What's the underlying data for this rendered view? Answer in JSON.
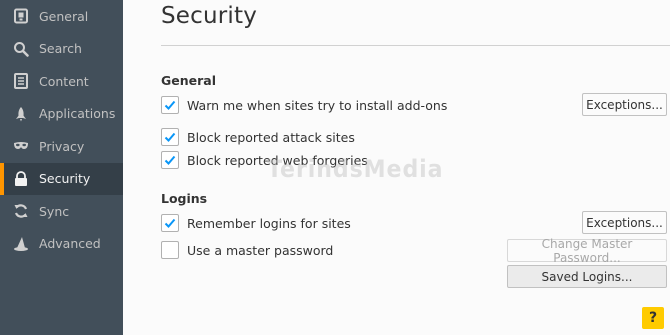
{
  "sidebar": {
    "items": [
      {
        "label": "General",
        "icon": "general-icon",
        "selected": false
      },
      {
        "label": "Search",
        "icon": "search-icon",
        "selected": false
      },
      {
        "label": "Content",
        "icon": "content-icon",
        "selected": false
      },
      {
        "label": "Applications",
        "icon": "rocket-icon",
        "selected": false
      },
      {
        "label": "Privacy",
        "icon": "mask-icon",
        "selected": false
      },
      {
        "label": "Security",
        "icon": "lock-icon",
        "selected": true
      },
      {
        "label": "Sync",
        "icon": "sync-icon",
        "selected": false
      },
      {
        "label": "Advanced",
        "icon": "wizard-hat-icon",
        "selected": false
      }
    ]
  },
  "page": {
    "title": "Security"
  },
  "general": {
    "heading": "General",
    "warn_addons": {
      "label": "Warn me when sites try to install add-ons",
      "checked": true
    },
    "block_attack": {
      "label": "Block reported attack sites",
      "checked": true
    },
    "block_forgeries": {
      "label": "Block reported web forgeries",
      "checked": true
    },
    "exceptions_label": "Exceptions..."
  },
  "logins": {
    "heading": "Logins",
    "remember": {
      "label": "Remember logins for sites",
      "checked": true
    },
    "master_password": {
      "label": "Use a master password",
      "checked": false
    },
    "exceptions_label": "Exceptions...",
    "change_master_label": "Change Master Password...",
    "saved_logins_label": "Saved Logins..."
  },
  "help": {
    "label": "?"
  },
  "watermark": {
    "text": "TerindsMedia"
  },
  "colors": {
    "sidebar_bg": "#424f5a",
    "sidebar_selected_bg": "#343f48",
    "accent": "#ff9500",
    "checkmark": "#0996f8",
    "help_bg": "#ffcb00"
  }
}
